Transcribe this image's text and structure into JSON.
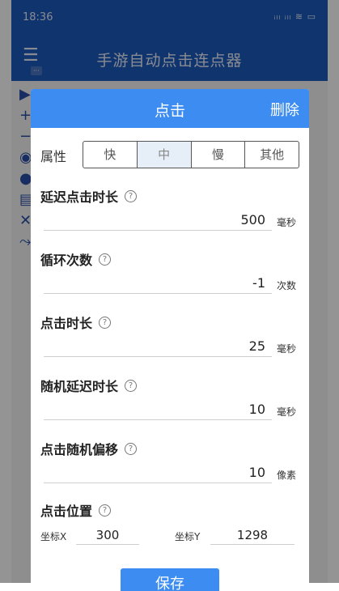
{
  "status_bar": {
    "time": "18:36",
    "icons": "ᵢₗₗ ᵢₗₗ ≋ ▭"
  },
  "app": {
    "title": "手游自动点击连点器",
    "side_badge": "···"
  },
  "dialog": {
    "title": "点击",
    "delete_label": "删除",
    "attribute": {
      "label": "属性",
      "options": [
        "快",
        "中",
        "慢",
        "其他"
      ],
      "selected": "中"
    },
    "fields": [
      {
        "label": "延迟点击时长",
        "value": "500",
        "unit": "毫秒"
      },
      {
        "label": "循环次数",
        "value": "-1",
        "unit": "次数"
      },
      {
        "label": "点击时长",
        "value": "25",
        "unit": "毫秒"
      },
      {
        "label": "随机延迟时长",
        "value": "10",
        "unit": "毫秒"
      },
      {
        "label": "点击随机偏移",
        "value": "10",
        "unit": "像素"
      }
    ],
    "position": {
      "label": "点击位置",
      "x_label": "坐标X",
      "x_value": "300",
      "y_label": "坐标Y",
      "y_value": "1298"
    },
    "save_label": "保存",
    "help_glyph": "?"
  },
  "colors": {
    "header": "#3c8cf2",
    "appbar": "#1c5cbd",
    "dim_overlay": "rgba(0,0,0,0.42)"
  }
}
